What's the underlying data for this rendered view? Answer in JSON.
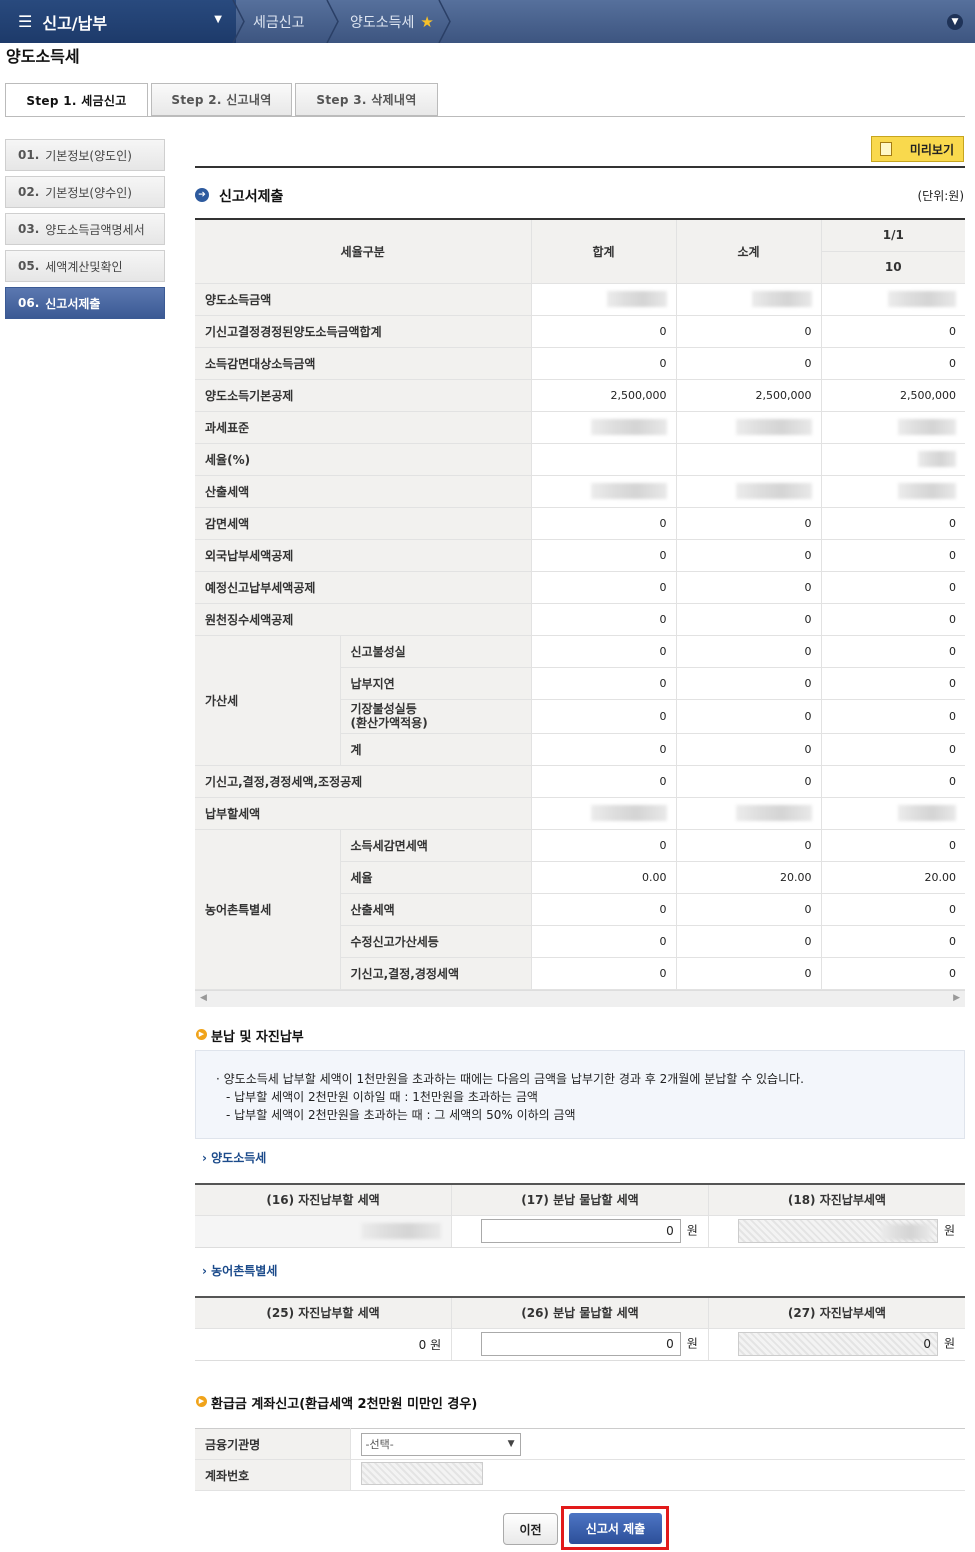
{
  "topbar": {
    "menu_label": "신고/납부",
    "breadcrumb": [
      "세금신고",
      "양도소득세"
    ]
  },
  "page_title": "양도소득세",
  "tabs": [
    "Step 1. 세금신고",
    "Step 2. 신고내역",
    "Step 3. 삭제내역"
  ],
  "sidebar": [
    {
      "num": "01.",
      "label": "기본정보(양도인)"
    },
    {
      "num": "02.",
      "label": "기본정보(양수인)"
    },
    {
      "num": "03.",
      "label": "양도소득금액명세서"
    },
    {
      "num": "05.",
      "label": "세액계산및확인"
    },
    {
      "num": "06.",
      "label": "신고서제출"
    }
  ],
  "preview_label": "미리보기",
  "section1": {
    "title": "신고서제출",
    "unit": "(단위:원)",
    "headers": {
      "category": "세율구분",
      "total": "합계",
      "subtotal": "소계",
      "page": "1/1",
      "col": "10"
    },
    "rows": [
      {
        "label": "양도소득금액",
        "v": [
          "",
          "",
          ""
        ]
      },
      {
        "label": "기신고결정경정된양도소득금액합계",
        "v": [
          "0",
          "0",
          "0"
        ]
      },
      {
        "label": "소득감면대상소득금액",
        "v": [
          "0",
          "0",
          "0"
        ]
      },
      {
        "label": "양도소득기본공제",
        "v": [
          "2,500,000",
          "2,500,000",
          "2,500,000"
        ]
      },
      {
        "label": "과세표준",
        "v": [
          "",
          "",
          ""
        ]
      },
      {
        "label": "세율(%)",
        "v": [
          "",
          "",
          ""
        ]
      },
      {
        "label": "산출세액",
        "v": [
          "",
          "",
          ""
        ]
      },
      {
        "label": "감면세액",
        "v": [
          "0",
          "0",
          "0"
        ]
      },
      {
        "label": "외국납부세액공제",
        "v": [
          "0",
          "0",
          "0"
        ]
      },
      {
        "label": "예정신고납부세액공제",
        "v": [
          "0",
          "0",
          "0"
        ]
      },
      {
        "label": "원천징수세액공제",
        "v": [
          "0",
          "0",
          "0"
        ]
      }
    ],
    "penalty": {
      "label": "가산세",
      "rows": [
        {
          "label": "신고불성실",
          "v": [
            "0",
            "0",
            "0"
          ]
        },
        {
          "label": "납부지연",
          "v": [
            "0",
            "0",
            "0"
          ]
        },
        {
          "label": "기장불성실등",
          "label2": "(환산가액적용)",
          "v": [
            "0",
            "0",
            "0"
          ]
        },
        {
          "label": "계",
          "v": [
            "0",
            "0",
            "0"
          ]
        }
      ]
    },
    "rows2": [
      {
        "label": "기신고,결정,경정세액,조정공제",
        "v": [
          "0",
          "0",
          "0"
        ]
      },
      {
        "label": "납부할세액",
        "v": [
          "",
          "",
          ""
        ]
      }
    ],
    "rural": {
      "label": "농어촌특별세",
      "rows": [
        {
          "label": "소득세감면세액",
          "v": [
            "0",
            "0",
            "0"
          ]
        },
        {
          "label": "세율",
          "v": [
            "0.00",
            "20.00",
            "20.00"
          ]
        },
        {
          "label": "산출세액",
          "v": [
            "0",
            "0",
            "0"
          ]
        },
        {
          "label": "수정신고가산세등",
          "v": [
            "0",
            "0",
            "0"
          ]
        },
        {
          "label": "기신고,결정,경정세액",
          "v": [
            "0",
            "0",
            "0"
          ]
        }
      ]
    }
  },
  "section2": {
    "title": "분납 및 자진납부",
    "notice": [
      "· 양도소득세 납부할 세액이 1천만원을 초과하는 때에는 다음의 금액을 납부기한 경과 후 2개월에 분납할 수 있습니다.",
      "- 납부할 세액이 2천만원 이하일 때 : 1천만원을 초과하는 금액",
      "- 납부할 세액이 2천만원을 초과하는 때 : 그 세액의 50% 이하의 금액"
    ],
    "transfer": {
      "title": "양도소득세",
      "headers": [
        "(16) 자진납부할 세액",
        "(17) 분납 물납할 세액",
        "(18) 자진납부세액"
      ],
      "installment_value": "0",
      "won": "원"
    },
    "rural": {
      "title": "농어촌특별세",
      "headers": [
        "(25) 자진납부할 세액",
        "(26) 분납 물납할 세액",
        "(27) 자진납부세액"
      ],
      "due": "0 원",
      "installment_value": "0",
      "self_value": "0",
      "won": "원"
    }
  },
  "section3": {
    "title": "환급금 계좌신고(환급세액 2천만원 미만인 경우)",
    "bank_label": "금융기관명",
    "bank_value": "-선택-",
    "account_label": "계좌번호"
  },
  "buttons": {
    "prev": "이전",
    "submit": "신고서 제출"
  },
  "colors": {
    "topbar": "#4a6290",
    "accent": "#2c4f99",
    "highlight": "#e21a1a",
    "preview": "#f9d94d"
  }
}
